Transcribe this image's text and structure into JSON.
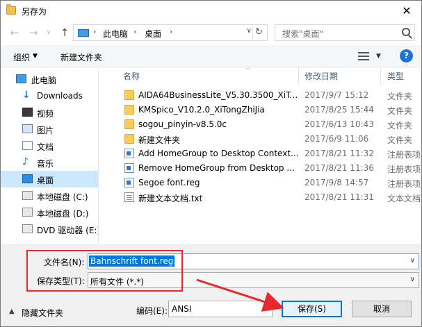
{
  "window": {
    "title": "另存为",
    "close_glyph": "✕"
  },
  "address": {
    "crumbs": [
      "此电脑",
      "桌面"
    ],
    "separator": "›",
    "search_placeholder": "搜索\"桌面\""
  },
  "toolbar": {
    "organize_label": "组织",
    "new_folder_label": "新建文件夹",
    "help_label": "?"
  },
  "sidebar": {
    "items": [
      {
        "label": "此电脑",
        "icon": "pc-icon",
        "top": true
      },
      {
        "label": "Downloads",
        "icon": "download-icon"
      },
      {
        "label": "视频",
        "icon": "video-icon"
      },
      {
        "label": "图片",
        "icon": "picture-icon"
      },
      {
        "label": "文档",
        "icon": "document-icon"
      },
      {
        "label": "音乐",
        "icon": "music-icon"
      },
      {
        "label": "桌面",
        "icon": "desktop-icon",
        "selected": true
      },
      {
        "label": "本地磁盘 (C:)",
        "icon": "drive-icon"
      },
      {
        "label": "本地磁盘 (D:)",
        "icon": "drive-icon"
      },
      {
        "label": "DVD 驱动器 (E:)",
        "icon": "dvd-icon"
      }
    ]
  },
  "filelist": {
    "headers": {
      "name": "名称",
      "modified": "修改日期",
      "type": "类型"
    },
    "rows": [
      {
        "name": "AIDA64BusinessLite_V5.30.3500_XiTo...",
        "date": "2017/9/7 15:12",
        "type": "文件夹",
        "icon": "folder-icon"
      },
      {
        "name": "KMSpico_V10.2.0_XiTongZhiJia",
        "date": "2017/8/25 15:44",
        "type": "文件夹",
        "icon": "folder-icon"
      },
      {
        "name": "sogou_pinyin-v8.5.0c",
        "date": "2017/6/13 10:43",
        "type": "文件夹",
        "icon": "folder-icon"
      },
      {
        "name": "新建文件夹",
        "date": "2017/6/9 11:06",
        "type": "文件夹",
        "icon": "folder-icon"
      },
      {
        "name": "Add HomeGroup to Desktop Context...",
        "date": "2017/8/21 11:32",
        "type": "注册表项",
        "icon": "reg-file-icon"
      },
      {
        "name": "Remove HomeGroup from Desktop ...",
        "date": "2017/8/21 11:36",
        "type": "注册表项",
        "icon": "reg-file-icon"
      },
      {
        "name": "Segoe font.reg",
        "date": "2017/9/8 14:57",
        "type": "注册表项",
        "icon": "reg-file-icon"
      },
      {
        "name": "新建文本文档.txt",
        "date": "2017/8/21 11:31",
        "type": "文本文档",
        "icon": "text-file-icon"
      }
    ]
  },
  "form": {
    "filename_label": "文件名(N):",
    "filename_value": "Bahnschrift font.reg",
    "type_label": "保存类型(T):",
    "type_value": "所有文件  (*.*)",
    "hide_folders_label": "隐藏文件夹",
    "encoding_label": "编码(E):",
    "encoding_value": "ANSI",
    "save_label": "保存(S)",
    "cancel_label": "取消"
  },
  "colors": {
    "accent": "#0078d7",
    "selection": "#cce8ff",
    "annotation_red": "#e8282a"
  }
}
